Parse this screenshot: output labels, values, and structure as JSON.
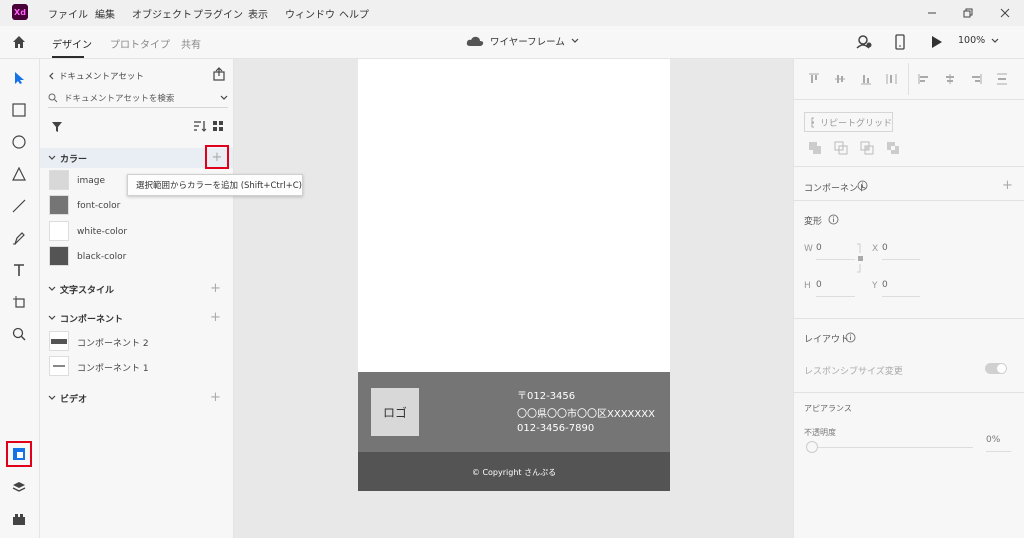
{
  "app": {
    "logo_text": "Xd"
  },
  "menu": [
    "ファイル",
    "編集",
    "オブジェクト",
    "プラグイン",
    "表示",
    "ウィンドウ",
    "ヘルプ"
  ],
  "modes": {
    "design": "デザイン",
    "prototype": "プロトタイプ",
    "share": "共有"
  },
  "document": {
    "title": "ワイヤーフレーム"
  },
  "zoom": "100%",
  "assets": {
    "back_label": "ドキュメントアセット",
    "search_placeholder": "ドキュメントアセットを検索",
    "colors_header": "カラー",
    "colors": [
      {
        "name": "image",
        "hex": "#d8d8d8"
      },
      {
        "name": "font-color",
        "hex": "#757575"
      },
      {
        "name": "white-color",
        "hex": "#ffffff"
      },
      {
        "name": "black-color",
        "hex": "#545454"
      }
    ],
    "text_styles_header": "文字スタイル",
    "components_header": "コンポーネント",
    "components": [
      "コンポーネント 2",
      "コンポーネント 1"
    ],
    "video_header": "ビデオ"
  },
  "tooltip": "選択範囲からカラーを追加 (Shift+Ctrl+C)",
  "artboard": {
    "logo_label": "ロゴ",
    "postal": "〒012-3456",
    "address": "〇〇県〇〇市〇〇区XXXXXXX",
    "phone": "012-3456-7890",
    "copyright": "© Copyright さんぷる"
  },
  "properties": {
    "repeat_grid": "リピートグリッド",
    "component": "コンポーネント",
    "transform": "変形",
    "w_label": "W",
    "w_value": "0",
    "x_label": "X",
    "x_value": "0",
    "h_label": "H",
    "h_value": "0",
    "y_label": "Y",
    "y_value": "0",
    "layout": "レイアウト",
    "responsive_resize": "レスポンシブサイズ変更",
    "appearance": "アピアランス",
    "opacity": "不透明度",
    "opacity_value": "0%"
  },
  "colors": {
    "highlight": "#e0001b",
    "accent": "#1473e6",
    "xd_bg": "#470137",
    "xd_fg": "#ff61f6"
  }
}
